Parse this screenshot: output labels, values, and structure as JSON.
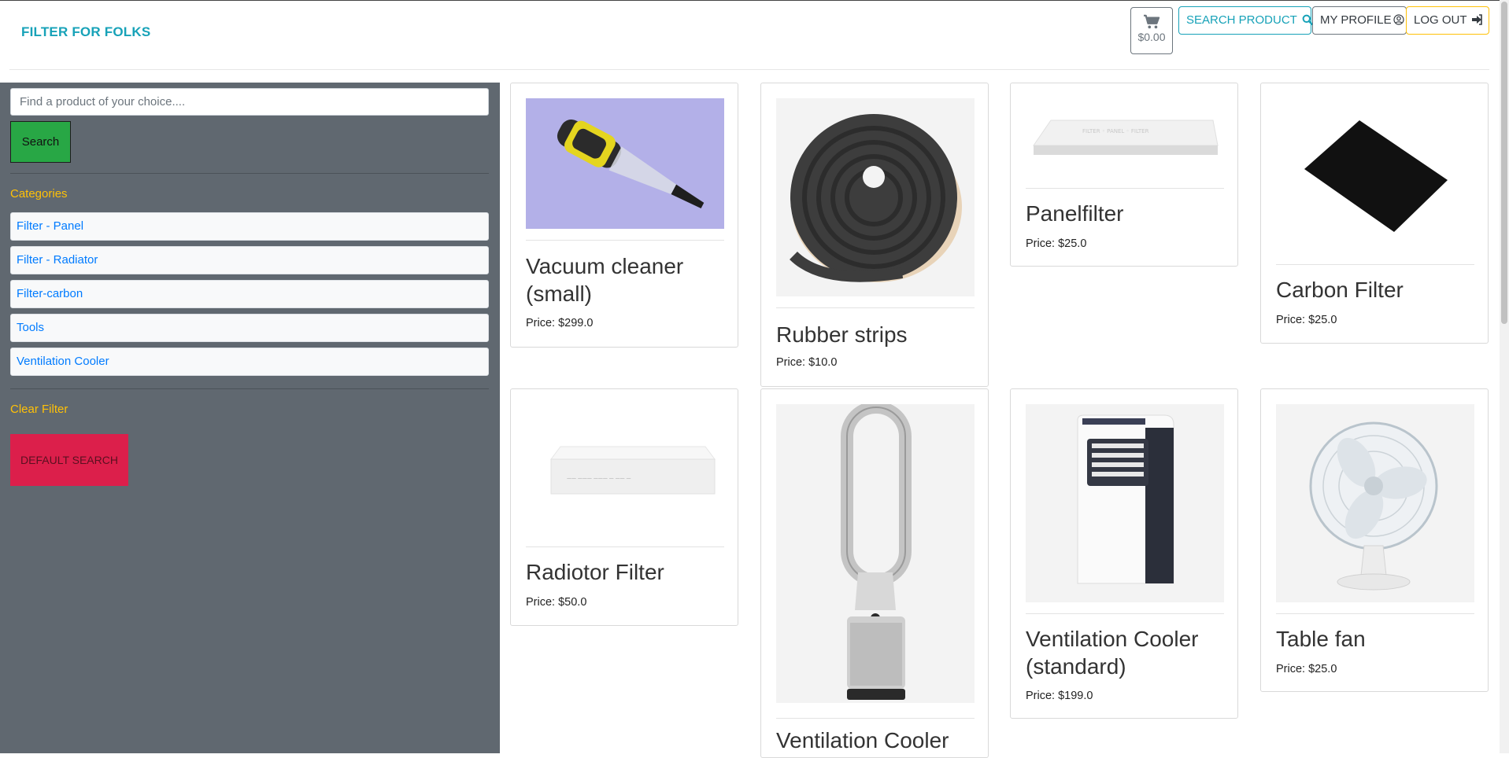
{
  "header": {
    "brand": "FILTER FOR FOLKS",
    "cart_total": "$0.00",
    "search_product": "SEARCH PRODUCT",
    "my_profile": "MY PROFILE",
    "log_out": "LOG OUT"
  },
  "sidebar": {
    "search_placeholder": "Find a product of your choice....",
    "search_button": "Search",
    "categories_title": "Categories",
    "categories": [
      "Filter - Panel",
      "Filter - Radiator",
      "Filter-carbon",
      "Tools",
      "Ventilation Cooler"
    ],
    "clear_filter": "Clear Filter",
    "default_search": "DEFAULT SEARCH"
  },
  "products": [
    {
      "title_lines": [
        "Vacuum cleaner",
        "(small)"
      ],
      "price": "Price: $299.0",
      "image": "handheld-vacuum-image"
    },
    {
      "title_lines": [
        "Rubber strips"
      ],
      "price": "Price: $10.0",
      "image": "rubber-strip-roll-image"
    },
    {
      "title_lines": [
        "Panelfilter"
      ],
      "price": "Price: $25.0",
      "image": "panel-filter-image"
    },
    {
      "title_lines": [
        "Carbon Filter"
      ],
      "price": "Price: $25.0",
      "image": "carbon-filter-image"
    },
    {
      "title_lines": [
        "Radiotor Filter"
      ],
      "price": "Price: $50.0",
      "image": "radiator-filter-image"
    },
    {
      "title_lines": [
        "Ventilation Cooler"
      ],
      "price": "",
      "image": "tower-purifier-image"
    },
    {
      "title_lines": [
        "Ventilation Cooler",
        "(standard)"
      ],
      "price": "Price: $199.0",
      "image": "portable-air-conditioner-image"
    },
    {
      "title_lines": [
        "Table fan"
      ],
      "price": "Price: $25.0",
      "image": "table-fan-image"
    }
  ],
  "colors": {
    "brand": "#17a2b8",
    "sidebar_bg": "#606870",
    "accent_yellow": "#ffc107",
    "search_green": "#28a745",
    "default_red": "#dc1f4b",
    "link_blue": "#007bff"
  }
}
